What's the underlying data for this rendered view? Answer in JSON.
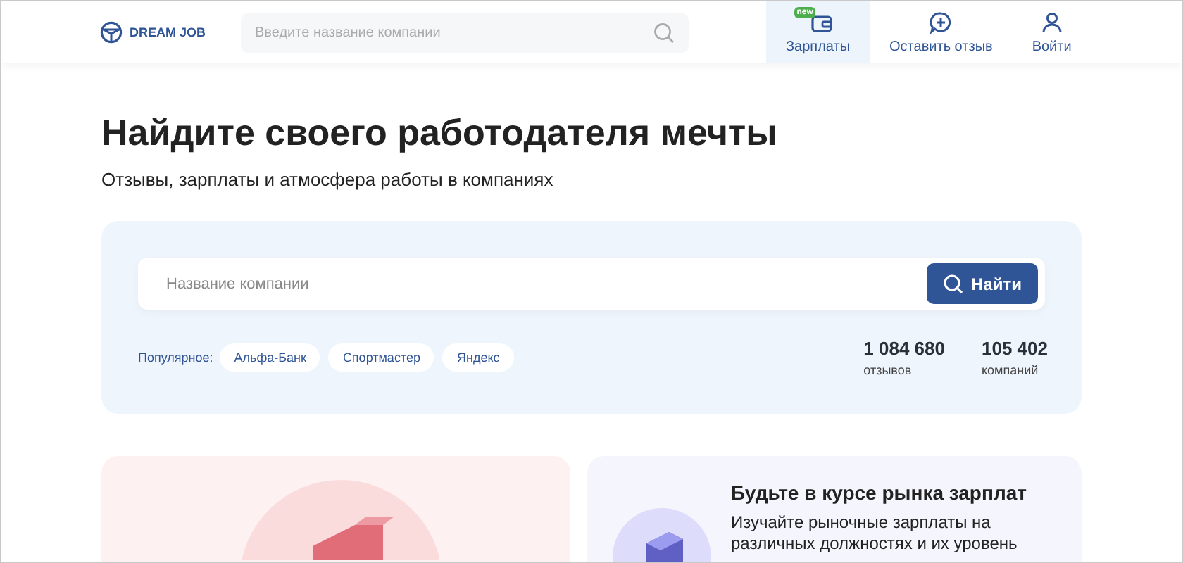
{
  "header": {
    "logo": "DREAM JOB",
    "search": {
      "placeholder": "Введите название компании"
    },
    "nav": [
      {
        "label": "Зарплаты",
        "badge": "new",
        "selected": true
      },
      {
        "label": "Оставить отзыв",
        "selected": false
      },
      {
        "label": "Войти",
        "selected": false
      }
    ]
  },
  "hero": {
    "title": "Найдите своего работодателя мечты",
    "subtitle": "Отзывы, зарплаты и атмосфера работы в компаниях"
  },
  "search_panel": {
    "placeholder": "Название компании",
    "button": "Найти",
    "popular_label": "Популярное:",
    "popular": [
      "Альфа-Банк",
      "Спортмастер",
      "Яндекс"
    ],
    "stats": [
      {
        "value": "1 084 680",
        "label": "отзывов"
      },
      {
        "value": "105 402",
        "label": "компаний"
      }
    ]
  },
  "cards": [
    {
      "kind": "illustration"
    },
    {
      "kind": "info",
      "title": "Будьте в курсе рынка зарплат",
      "text": "Изучайте рыночные зарплаты на различных должностях и их уровень"
    }
  ]
}
